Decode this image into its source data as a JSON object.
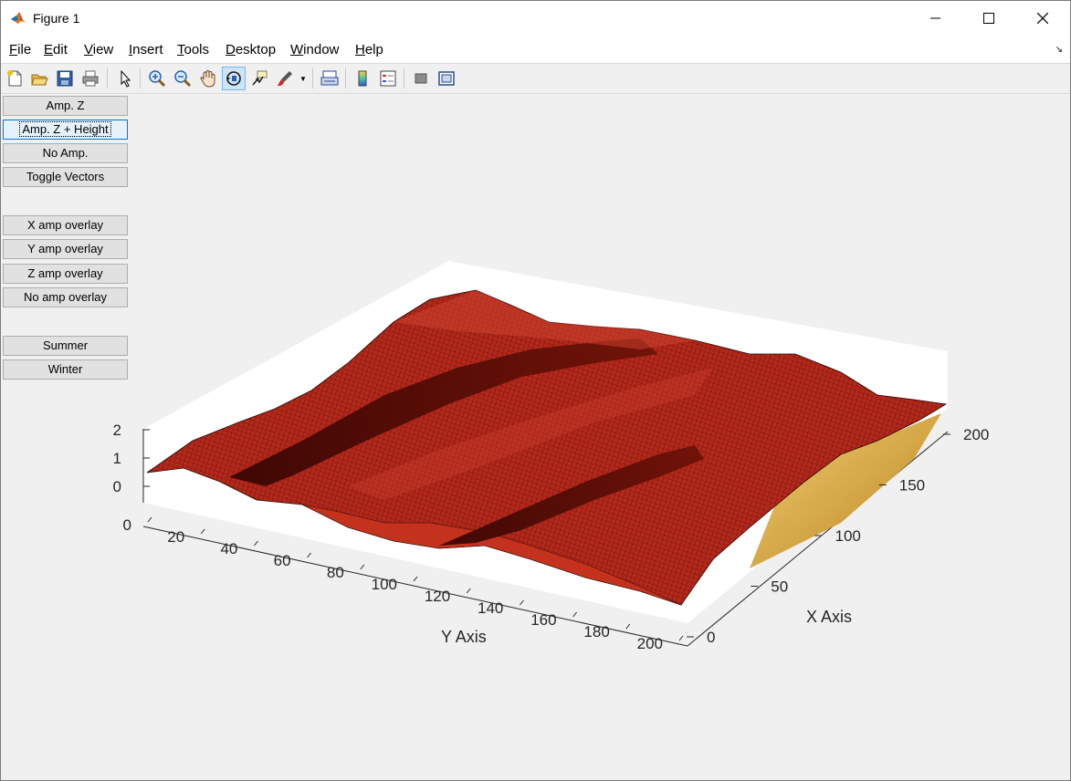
{
  "window": {
    "title": "Figure 1"
  },
  "menu": [
    {
      "pre": "",
      "key": "F",
      "post": "ile"
    },
    {
      "pre": "",
      "key": "E",
      "post": "dit"
    },
    {
      "pre": "",
      "key": "V",
      "post": "iew"
    },
    {
      "pre": "",
      "key": "I",
      "post": "nsert"
    },
    {
      "pre": "",
      "key": "T",
      "post": "ools"
    },
    {
      "pre": "",
      "key": "D",
      "post": "esktop"
    },
    {
      "pre": "",
      "key": "W",
      "post": "indow"
    },
    {
      "pre": "",
      "key": "H",
      "post": "elp"
    }
  ],
  "toolbar": {
    "icons": [
      "new-figure-icon",
      "open-file-icon",
      "save-icon",
      "print-icon",
      "edit-plot-arrow-icon",
      "zoom-in-icon",
      "zoom-out-icon",
      "pan-hand-icon",
      "rotate-3d-icon",
      "data-cursor-icon",
      "brush-icon",
      "link-plot-icon",
      "colorbar-icon",
      "legend-icon",
      "hide-plot-tools-icon",
      "show-plot-tools-icon"
    ],
    "active": "rotate-3d-icon"
  },
  "buttons": {
    "amp_z": "Amp. Z",
    "amp_z_height": "Amp. Z + Height",
    "no_amp": "No Amp.",
    "toggle_vectors": "Toggle Vectors",
    "x_amp_overlay": "X amp overlay",
    "y_amp_overlay": "Y amp overlay",
    "z_amp_overlay": "Z amp overlay",
    "no_amp_overlay": "No amp overlay",
    "summer": "Summer",
    "winter": "Winter"
  },
  "colors": {
    "surface": "#b3281a",
    "surface_dark": "#5a0d05",
    "edge": "#000000",
    "floor": "#d9a441"
  },
  "chart_data": {
    "type": "surface3d",
    "xlabel": "X Axis",
    "ylabel": "Y Axis",
    "xlim": [
      0,
      220
    ],
    "ylim": [
      0,
      200
    ],
    "zlim": [
      0,
      2
    ],
    "xticks": [
      0,
      50,
      100,
      150,
      200
    ],
    "yticks": [
      0,
      20,
      40,
      60,
      80,
      100,
      120,
      140,
      160,
      180,
      200
    ],
    "zticks": [
      0,
      1,
      2
    ],
    "description": "terrain surface with two parallel dark channels along the Y direction"
  }
}
